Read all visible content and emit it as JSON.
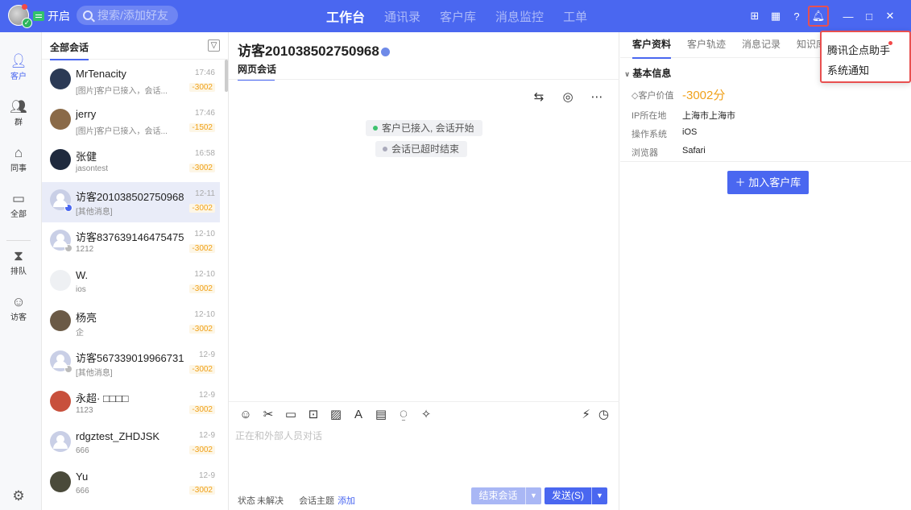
{
  "topbar": {
    "open_label": "开启",
    "search_placeholder": "搜索/添加好友",
    "tabs": [
      "工作台",
      "通讯录",
      "客户库",
      "消息监控",
      "工单"
    ],
    "tool_icons": [
      "add-box-icon",
      "apps-grid-icon",
      "help-icon",
      "bell-icon",
      "minimize-icon",
      "maximize-icon",
      "close-icon"
    ]
  },
  "rail": {
    "items": [
      {
        "label": "客户",
        "icon": "customer-icon"
      },
      {
        "label": "群",
        "icon": "group-icon"
      },
      {
        "label": "同事",
        "icon": "colleague-icon"
      },
      {
        "label": "全部",
        "icon": "chat-all-icon"
      },
      {
        "label": "排队",
        "icon": "hourglass-icon"
      },
      {
        "label": "访客",
        "icon": "visitor-icon"
      }
    ],
    "bottom_icon": "settings-icon"
  },
  "convlist": {
    "title": "全部会话",
    "items": [
      {
        "name": "MrTenacity",
        "time": "17:46",
        "sub": "[图片]客户已接入，会话...",
        "val": "-3002"
      },
      {
        "name": "jerry",
        "time": "17:46",
        "sub": "[图片]客户已接入，会话...",
        "val": "-1502"
      },
      {
        "name": "张健",
        "time": "16:58",
        "sub": "jasontest",
        "val": "-3002"
      },
      {
        "name": "访客201038502750968",
        "time": "12-11",
        "sub": "[其他消息]",
        "val": "-3002"
      },
      {
        "name": "访客837639146475475",
        "time": "12-10",
        "sub": "1212",
        "val": "-3002"
      },
      {
        "name": "W.",
        "time": "12-10",
        "sub": "ios",
        "val": "-3002"
      },
      {
        "name": "杨亮",
        "time": "12-10",
        "sub": "企",
        "val": "-3002"
      },
      {
        "name": "访客567339019966731",
        "time": "12-9",
        "sub": "[其他消息]",
        "val": "-3002"
      },
      {
        "name": "永超· □□□□",
        "time": "12-9",
        "sub": "1123",
        "val": "-3002"
      },
      {
        "name": "rdgztest_ZHDJSK",
        "time": "12-9",
        "sub": "666",
        "val": "-3002"
      },
      {
        "name": "Yu",
        "time": "12-9",
        "sub": "666",
        "val": "-3002"
      }
    ]
  },
  "chat": {
    "title": "访客201038502750968",
    "subtab": "网页会话",
    "system_messages": [
      "客户已接入, 会话开始",
      "会话已超时结束"
    ],
    "placeholder": "正在和外部人员对话",
    "status_label": "状态",
    "status_value": "未解决",
    "topic_label": "会话主题",
    "topic_add": "添加",
    "end_button": "结束会话",
    "send_button": "发送(S)"
  },
  "panel": {
    "tabs": [
      "客户资料",
      "客户轨迹",
      "消息记录",
      "知识库"
    ],
    "section": "基本信息",
    "fields": [
      {
        "label": "客户价值",
        "value": "-3002分"
      },
      {
        "label": "IP所在地",
        "value": "上海市上海市"
      },
      {
        "label": "操作系统",
        "value": "iOS"
      },
      {
        "label": "浏览器",
        "value": "Safari"
      }
    ],
    "add_button": "加入客户库"
  },
  "popup": {
    "items": [
      "腾讯企点助手",
      "系统通知"
    ]
  }
}
